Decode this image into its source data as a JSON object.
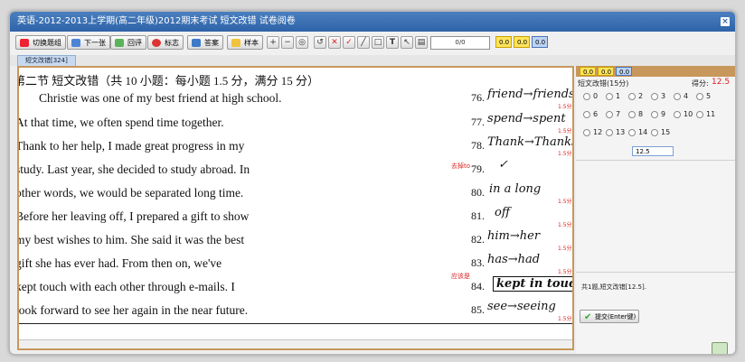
{
  "window": {
    "title": "英语-2012-2013上学期(高二年级)2012期末考试 短文改错 试卷阅卷",
    "close_symbol": "×"
  },
  "toolbar": {
    "buttons": [
      "切换题组",
      "下一张",
      "回评",
      "标志",
      "答案",
      "样本"
    ],
    "progress": "0/0",
    "yellow_scores": [
      "0.0",
      "0.0"
    ],
    "blue_score": "0.0"
  },
  "tab": {
    "label": "短文改错[324]"
  },
  "answer": {
    "heading": "第二节 短文改错（共 10 小题：每小题 1.5 分，满分 15 分）",
    "lines": [
      "Christie was one of my best friend at high school.",
      "At that time, we often spend time together.",
      "Thank to her help, I made great progress in my",
      "study. Last year, she decided to study abroad. In",
      "other words, we would be separated long time.",
      "Before her leaving off, I prepared a gift to show",
      "my best wishes to him. She said it was the best",
      "gift she has ever had. From then on, we've",
      "kept touch with each other through e-mails. I",
      "look forward to see her again in the near future."
    ],
    "numbers": [
      "76.",
      "77.",
      "78.",
      "79.",
      "80.",
      "81.",
      "82.",
      "83.",
      "84.",
      "85."
    ],
    "handwritten": [
      "friend→friends",
      "spend→spent",
      "Thank→Thanks",
      "✓",
      "in a long",
      "off",
      "him→her",
      "has→had",
      "kept in touch",
      "see→seeing"
    ],
    "score_marks": [
      "1.5分",
      "1.5分",
      "1.5分",
      "1.5分",
      "1.5分",
      "1.5分",
      "1.5分",
      "1.5分"
    ],
    "notes": [
      "去掉to",
      "应该是"
    ]
  },
  "right": {
    "scores": [
      "0.0",
      "0.0",
      "0.0"
    ],
    "question_label": "短文改错(15分)",
    "score_label": "得分:",
    "score_value": "12.5",
    "options": [
      "0",
      "1",
      "2",
      "3",
      "4",
      "5",
      "6",
      "7",
      "8",
      "9",
      "10",
      "11",
      "12",
      "13",
      "14",
      "15"
    ],
    "input_value": "12.5",
    "summary": "共1题,短文改错[12.5].",
    "submit": "提交(Enter键)"
  },
  "colors": {
    "accent": "#2f63a8",
    "border": "#c7975b",
    "mark": "#d22222"
  }
}
